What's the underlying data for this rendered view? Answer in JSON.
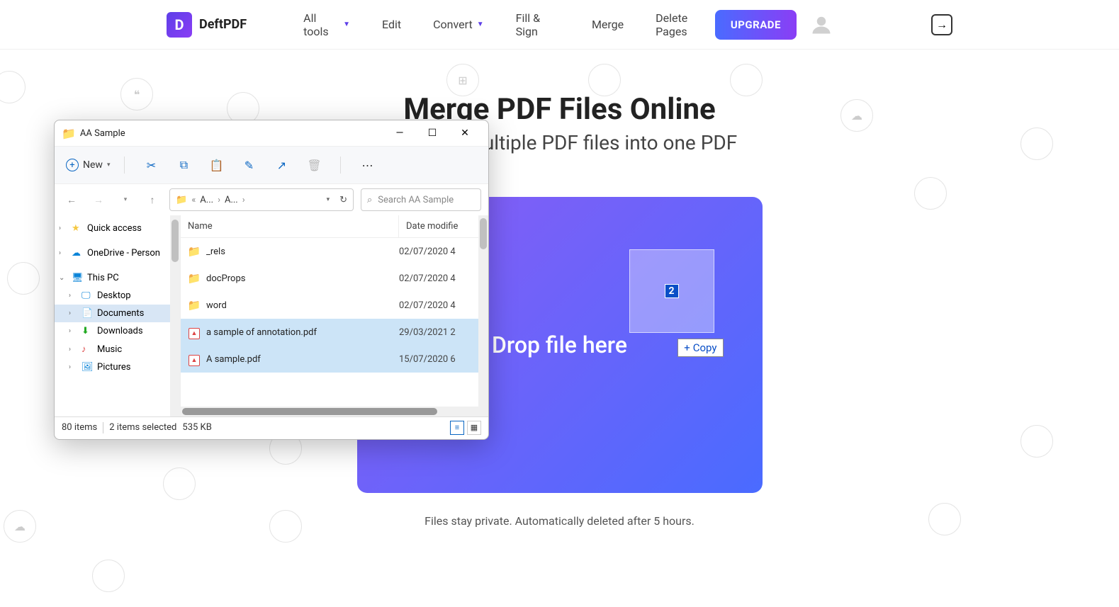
{
  "header": {
    "logo_letter": "D",
    "logo_text": "DeftPDF",
    "nav": [
      "All tools",
      "Edit",
      "Convert",
      "Fill & Sign",
      "Merge",
      "Delete Pages"
    ],
    "upgrade": "UPGRADE"
  },
  "main": {
    "title": "Merge PDF Files Online",
    "subtitle": "Combine multiple PDF files into one PDF",
    "drop_text": "Drop file here",
    "drag_count": "2",
    "copy_tip": "Copy",
    "privacy": "Files stay private. Automatically deleted after 5 hours."
  },
  "explorer": {
    "title": "AA Sample",
    "new_label": "New",
    "breadcrumb": {
      "a1": "A...",
      "a2": "A..."
    },
    "search_placeholder": "Search AA Sample",
    "tree": {
      "quick_access": "Quick access",
      "onedrive": "OneDrive - Person",
      "this_pc": "This PC",
      "desktop": "Desktop",
      "documents": "Documents",
      "downloads": "Downloads",
      "music": "Music",
      "pictures": "Pictures"
    },
    "columns": {
      "name": "Name",
      "date": "Date modifie"
    },
    "files": [
      {
        "name": "_rels",
        "date": "02/07/2020 4",
        "type": "folder",
        "sel": false
      },
      {
        "name": "docProps",
        "date": "02/07/2020 4",
        "type": "folder",
        "sel": false
      },
      {
        "name": "word",
        "date": "02/07/2020 4",
        "type": "folder",
        "sel": false
      },
      {
        "name": "a sample of annotation.pdf",
        "date": "29/03/2021 2",
        "type": "pdf",
        "sel": true
      },
      {
        "name": "A sample.pdf",
        "date": "15/07/2020 6",
        "type": "pdf",
        "sel": true
      }
    ],
    "status": {
      "items": "80 items",
      "selected": "2 items selected",
      "size": "535 KB"
    }
  }
}
